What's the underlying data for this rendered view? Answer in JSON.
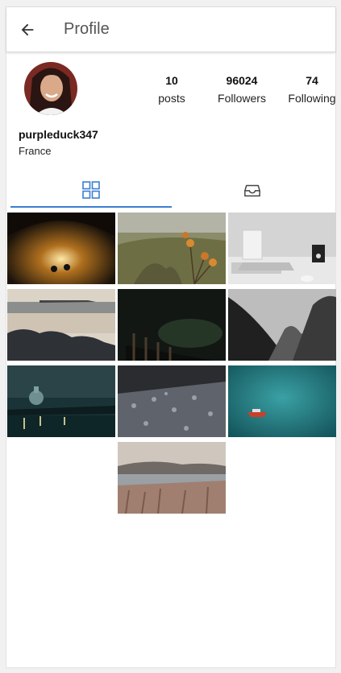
{
  "header": {
    "title": "Profile",
    "back_icon": "arrow-left-icon"
  },
  "profile": {
    "username": "purpleduck347",
    "location": "France",
    "stats": [
      {
        "count": "10",
        "label": "posts"
      },
      {
        "count": "96024",
        "label": "Followers"
      },
      {
        "count": "74",
        "label": "Following"
      }
    ]
  },
  "tabs": [
    {
      "icon": "grid-icon",
      "active": true
    },
    {
      "icon": "inbox-icon",
      "active": false
    }
  ],
  "colors": {
    "accent": "#3b7fd1",
    "background": "#f1f1f1"
  },
  "photos": [
    "tunnel-silhouettes-photo",
    "thistle-valley-photo",
    "laptop-desk-photo",
    "rocky-beach-photo",
    "night-sky-fence-photo",
    "misty-mountains-photo",
    "city-river-night-photo",
    "water-droplets-photo",
    "red-boat-teal-water-photo",
    "lake-dry-grass-photo"
  ]
}
